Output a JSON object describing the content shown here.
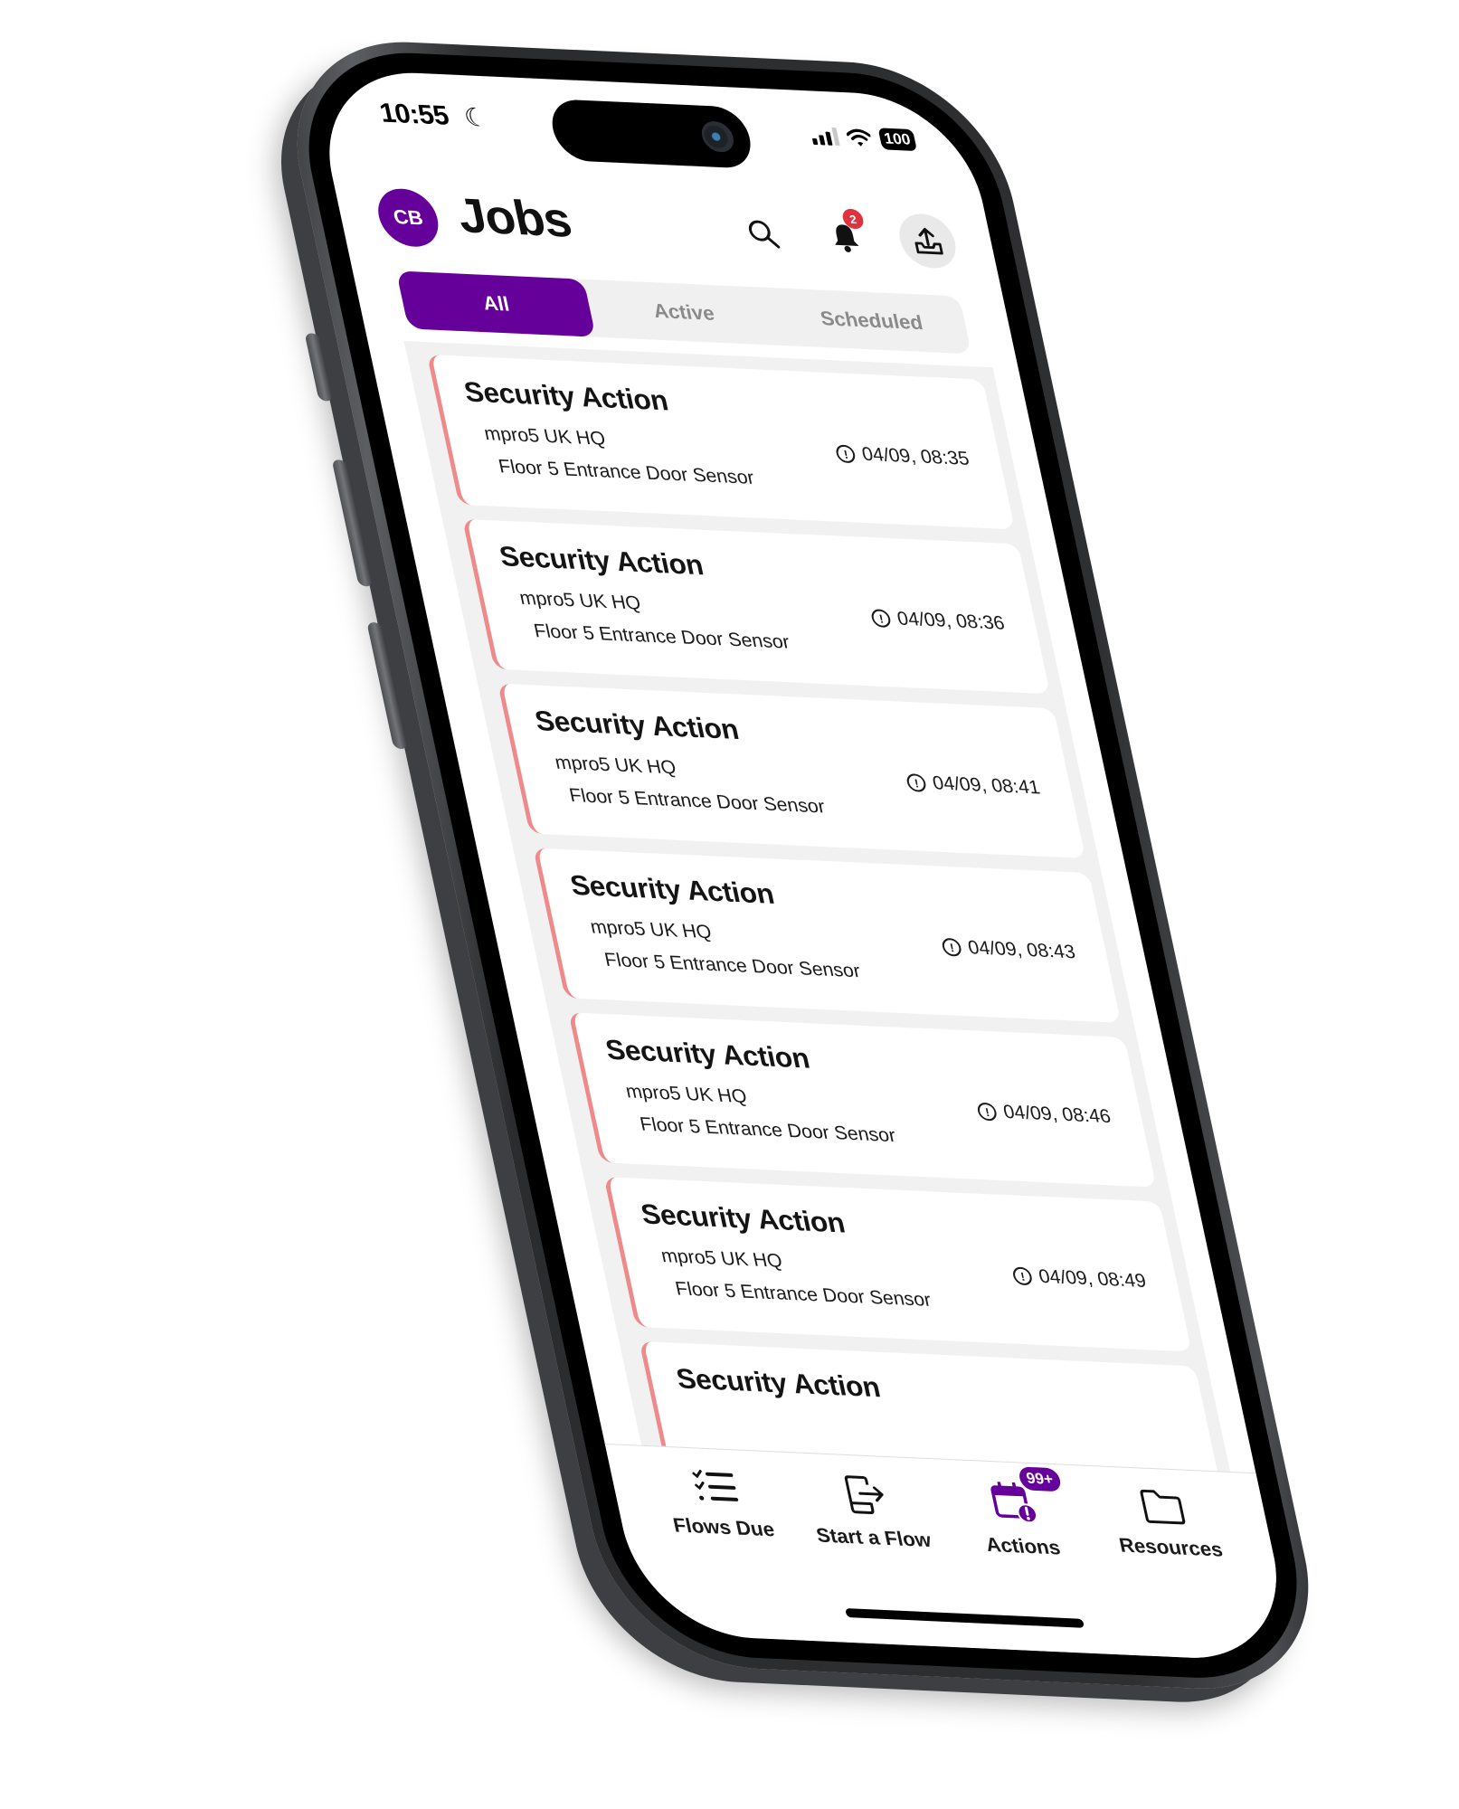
{
  "status_bar": {
    "time": "10:55",
    "focus_icon": "moon-icon",
    "battery": "100"
  },
  "header": {
    "avatar_initials": "CB",
    "title": "Jobs",
    "notification_count": "2",
    "icons": [
      "search-icon",
      "bell-icon",
      "upload-icon"
    ]
  },
  "tabs": [
    {
      "label": "All",
      "active": true
    },
    {
      "label": "Active",
      "active": false
    },
    {
      "label": "Scheduled",
      "active": false
    }
  ],
  "jobs": [
    {
      "title": "Security Action",
      "site": "mpro5 UK HQ",
      "location": "Floor 5 Entrance Door Sensor",
      "time": "04/09, 08:35"
    },
    {
      "title": "Security Action",
      "site": "mpro5 UK HQ",
      "location": "Floor 5 Entrance Door Sensor",
      "time": "04/09, 08:36"
    },
    {
      "title": "Security Action",
      "site": "mpro5 UK HQ",
      "location": "Floor 5 Entrance Door Sensor",
      "time": "04/09, 08:41"
    },
    {
      "title": "Security Action",
      "site": "mpro5 UK HQ",
      "location": "Floor 5 Entrance Door Sensor",
      "time": "04/09, 08:43"
    },
    {
      "title": "Security Action",
      "site": "mpro5 UK HQ",
      "location": "Floor 5 Entrance Door Sensor",
      "time": "04/09, 08:46"
    },
    {
      "title": "Security Action",
      "site": "mpro5 UK HQ",
      "location": "Floor 5 Entrance Door Sensor",
      "time": "04/09, 08:49"
    },
    {
      "title": "Security Action",
      "site": "",
      "location": "",
      "time": ""
    }
  ],
  "bottom_nav": [
    {
      "label": "Flows Due",
      "icon": "checklist-icon",
      "badge": ""
    },
    {
      "label": "Start a Flow",
      "icon": "start-flow-icon",
      "badge": ""
    },
    {
      "label": "Actions",
      "icon": "calendar-alert-icon",
      "badge": "99+"
    },
    {
      "label": "Resources",
      "icon": "folder-icon",
      "badge": ""
    }
  ],
  "colors": {
    "brand": "#65009a",
    "job_accent": "#ee8a8a",
    "notification_badge": "#e0313e"
  }
}
